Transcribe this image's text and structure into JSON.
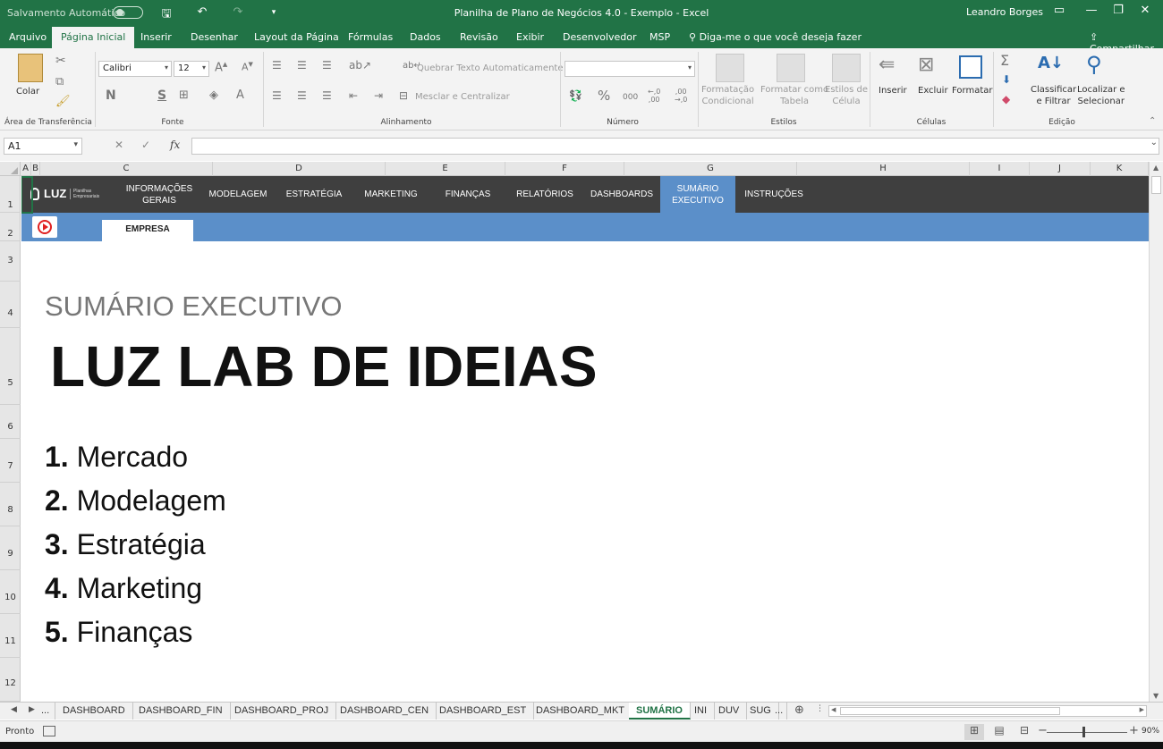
{
  "titlebar": {
    "autosave_label": "Salvamento Automático",
    "doc_title": "Planilha de Plano de Negócios 4.0 - Exemplo  -  Excel",
    "user": "Leandro Borges"
  },
  "ribbon_tabs": [
    "Arquivo",
    "Página Inicial",
    "Inserir",
    "Desenhar",
    "Layout da Página",
    "Fórmulas",
    "Dados",
    "Revisão",
    "Exibir",
    "Desenvolvedor",
    "MSP"
  ],
  "tell_me": "Diga-me o que você deseja fazer",
  "share": "Compartilhar",
  "ribbon": {
    "paste": "Colar",
    "clipboard_group": "Área de Transferência",
    "font_name": "Calibri",
    "font_size": "12",
    "bold": "N",
    "strike": "S",
    "font_group": "Fonte",
    "wrap_text": "Quebrar Texto Automaticamente",
    "merge_center": "Mesclar e Centralizar",
    "alignment_group": "Alinhamento",
    "percent": "%",
    "thousands": "000",
    "inc_dec": "←,0\n,00",
    "dec_dec": ",00\n→,0",
    "number_group": "Número",
    "cond_format": "Formatação\nCondicional",
    "format_table": "Formatar como\nTabela",
    "cell_styles": "Estilos de\nCélula",
    "styles_group": "Estilos",
    "insert": "Inserir",
    "delete": "Excluir",
    "format": "Formatar",
    "cells_group": "Células",
    "sort_filter": "Classificar\ne Filtrar",
    "find_select": "Localizar e\nSelecionar",
    "editing_group": "Edição"
  },
  "formula_bar": {
    "name_box": "A1",
    "fx": "fx",
    "cancel": "✕",
    "enter": "✓",
    "value": ""
  },
  "columns": [
    "A",
    "B",
    "C",
    "D",
    "E",
    "F",
    "G",
    "H",
    "I",
    "J",
    "K"
  ],
  "rows": [
    "1",
    "2",
    "3",
    "4",
    "5",
    "6",
    "7",
    "8",
    "9",
    "10",
    "11",
    "12"
  ],
  "nav": {
    "logo": "LUZ",
    "logo_sub": "Planilhas\nEmpresariais",
    "items": [
      "INFORMAÇÕES\nGERAIS",
      "MODELAGEM",
      "ESTRATÉGIA",
      "MARKETING",
      "FINANÇAS",
      "RELATÓRIOS",
      "DASHBOARDS",
      "SUMÁRIO\nEXECUTIVO",
      "INSTRUÇÕES"
    ],
    "active": "SUMÁRIO\nEXECUTIVO",
    "empresa": "EMPRESA"
  },
  "content": {
    "subtitle": "SUMÁRIO EXECUTIVO",
    "title": "LUZ LAB DE IDEIAS",
    "items": [
      {
        "num": "1.",
        "label": "Mercado"
      },
      {
        "num": "2.",
        "label": "Modelagem"
      },
      {
        "num": "3.",
        "label": "Estratégia"
      },
      {
        "num": "4.",
        "label": "Marketing"
      },
      {
        "num": "5.",
        "label": "Finanças"
      }
    ]
  },
  "sheet_tabs": {
    "ellipsis": "...",
    "tabs": [
      "DASHBOARD",
      "DASHBOARD_FIN",
      "DASHBOARD_PROJ",
      "DASHBOARD_CEN",
      "DASHBOARD_EST",
      "DASHBOARD_MKT",
      "SUMÁRIO",
      "INI",
      "DUV",
      "SUG"
    ],
    "active": "SUMÁRIO"
  },
  "status": {
    "ready": "Pronto",
    "zoom": "90%"
  },
  "colors": {
    "excel_green": "#217346",
    "nav_dark": "#3f3f3f",
    "nav_blue": "#5b8fc9"
  }
}
